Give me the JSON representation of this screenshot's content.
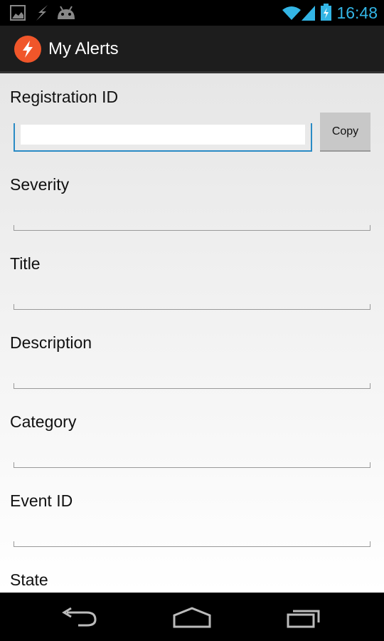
{
  "status_bar": {
    "time": "16:48",
    "icons": [
      "gallery-icon",
      "flash-icon",
      "android-icon",
      "wifi-icon",
      "signal-icon",
      "battery-charging-icon"
    ]
  },
  "action_bar": {
    "title": "My Alerts",
    "icon": "lightning-bolt-icon",
    "accent": "#f0562a"
  },
  "form": {
    "registration": {
      "label": "Registration ID",
      "value": "",
      "copy_label": "Copy"
    },
    "fields": [
      {
        "label": "Severity",
        "value": ""
      },
      {
        "label": "Title",
        "value": ""
      },
      {
        "label": "Description",
        "value": ""
      },
      {
        "label": "Category",
        "value": ""
      },
      {
        "label": "Event ID",
        "value": ""
      },
      {
        "label": "State",
        "value": ""
      }
    ]
  },
  "nav_bar": {
    "icons": [
      "back-icon",
      "home-icon",
      "recent-apps-icon"
    ]
  }
}
